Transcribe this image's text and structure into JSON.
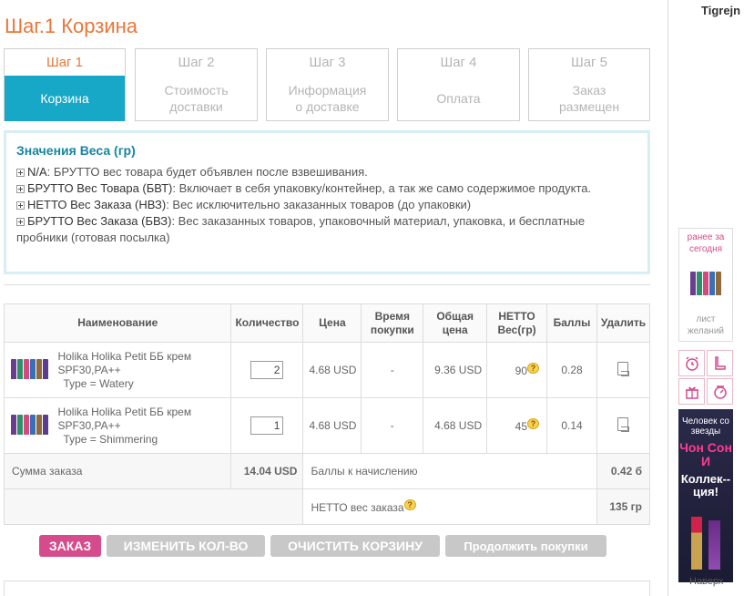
{
  "page_title": "Шаг.1 Корзина",
  "steps": [
    {
      "num": "Шаг 1",
      "label": "Корзина"
    },
    {
      "num": "Шаг 2",
      "label": "Стоимость доставки"
    },
    {
      "num": "Шаг 3",
      "label": "Информация о доставке"
    },
    {
      "num": "Шаг 4",
      "label": "Оплата"
    },
    {
      "num": "Шаг 5",
      "label": "Заказ размещен"
    }
  ],
  "weights": {
    "title": "Значения Веса (гр)",
    "items": [
      {
        "key": "N/A",
        "text": ": БРУТТО вес товара будет объявлен после взвешивания."
      },
      {
        "key": "БРУТТО Вес Товара (БВТ)",
        "text": ": Включает в себя упаковку/контейнер, а так же само содержимое продукта."
      },
      {
        "key": "НЕТТО Вес Заказа (НВЗ)",
        "text": ": Вес исключительно заказанных товаров (до упаковки)"
      },
      {
        "key": "БРУТТО Вес Заказа (БВЗ)",
        "text": ": Вес заказанных товаров, упаковочный материал, упаковка, и бесплатные пробники (готовая посылка)"
      }
    ]
  },
  "table": {
    "headers": {
      "name": "Наименование",
      "qty": "Количество",
      "price": "Цена",
      "time": "Время покупки",
      "total": "Общая цена",
      "netto": "НЕТТО Вес(гр)",
      "points": "Баллы",
      "delete": "Удалить"
    },
    "rows": [
      {
        "name": "Holika Holika Petit ББ крем SPF30,PA++",
        "type": "Type = Watery",
        "qty": "2",
        "price": "4.68 USD",
        "time": "-",
        "total": "9.36 USD",
        "netto": "90",
        "points": "0.28"
      },
      {
        "name": "Holika Holika Petit ББ крем SPF30,PA++",
        "type": "Type = Shimmering",
        "qty": "1",
        "price": "4.68 USD",
        "time": "-",
        "total": "4.68 USD",
        "netto": "45",
        "points": "0.14"
      }
    ],
    "sum_label": "Сумма заказа",
    "sum_value": "14.04 USD",
    "points_label": "Баллы к начислению",
    "points_value": "0.42 б",
    "netto_label": "НЕТТО вес заказа",
    "netto_value": "135 гр"
  },
  "buttons": {
    "order": "ЗАКАЗ",
    "change": "ИЗМЕНИТЬ КОЛ-ВО",
    "clear": "ОЧИСТИТЬ КОРЗИНУ",
    "continue": "Продолжить покупки"
  },
  "sidebar": {
    "username": "Tigrejn",
    "recent": "ранее за сегодня",
    "wishlist": "лист желаний",
    "ad_line1": "Человек со звезды",
    "ad_line2": "Чон Сон И",
    "ad_line3": "Коллек--ция!",
    "up": "Наверх"
  },
  "colors": {
    "accent": "#e8773a",
    "teal": "#17a8c7",
    "pink": "#d64b8b"
  }
}
